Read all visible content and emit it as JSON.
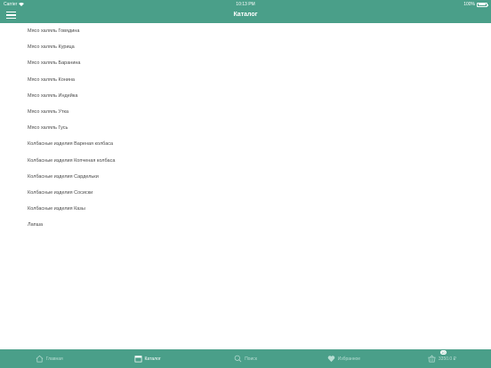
{
  "status_bar": {
    "carrier": "Carrier",
    "time": "10:13 PM",
    "battery_text": "100%",
    "battery_level": 1.0
  },
  "nav": {
    "title": "Каталог",
    "menu_icon": "hamburger-icon"
  },
  "catalog": [
    "Мясо халяль Говядина",
    "Мясо халяль Курица",
    "Мясо халяль Баранина",
    "Мясо халяль Конина",
    "Мясо халяль Индейка",
    "Мясо халяль Утка",
    "Мясо халяль Гусь",
    "Колбасные изделия Вареная колбаса",
    "Колбасные изделия Копченая колбаса",
    "Колбасные изделия Сардельки",
    "Колбасные изделия Сосиски",
    "Колбасные изделия Казы",
    "Лапша"
  ],
  "tabs": [
    {
      "label": "Главная",
      "icon": "home-icon",
      "active": false
    },
    {
      "label": "Каталог",
      "icon": "calendar-icon",
      "active": true
    },
    {
      "label": "Поиск",
      "icon": "search-icon",
      "active": false
    },
    {
      "label": "Избранное",
      "icon": "heart-icon",
      "active": false
    },
    {
      "label": "3350.0 ₽",
      "icon": "cart-icon",
      "active": false,
      "badge": "10"
    }
  ],
  "colors": {
    "primary": "#4a9f89",
    "text": "#4a4a4a",
    "tab_inactive": "#b8ddd3"
  }
}
